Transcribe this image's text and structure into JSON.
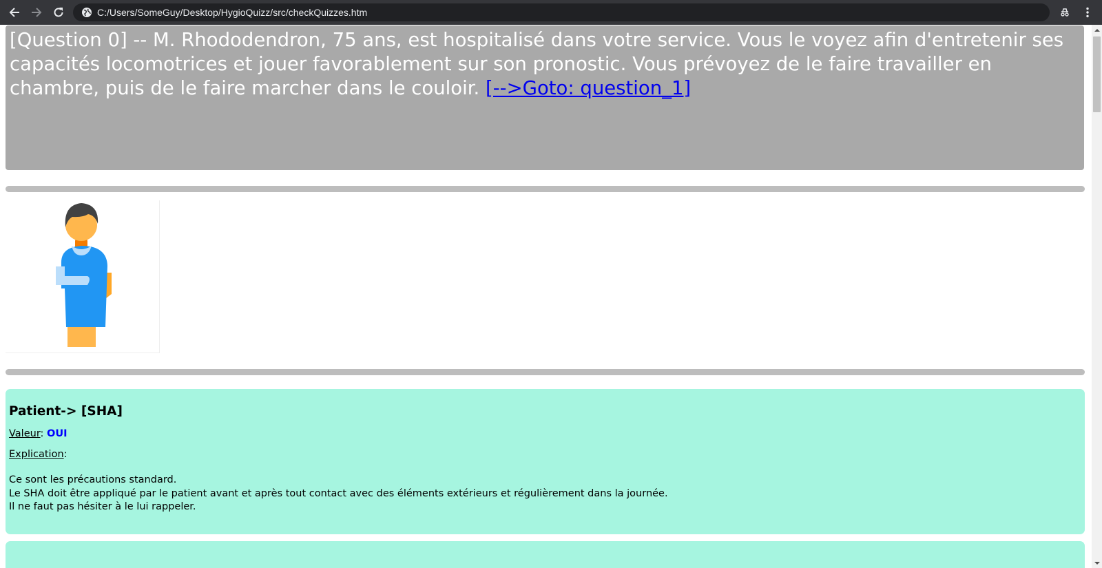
{
  "browser": {
    "url": "C:/Users/SomeGuy/Desktop/HygioQuizz/src/checkQuizzes.htm"
  },
  "question": {
    "text": "[Question 0] -- M. Rhododendron, 75 ans, est hospitalisé dans votre service. Vous le voyez afin d'entretenir ses capacités locomotrices et jouer favorablement sur son pronostic. Vous prévoyez de le faire travailler en chambre, puis de le faire marcher dans le couloir. ",
    "goto_link": "[-->Goto:  question_1]"
  },
  "answer": {
    "title": "Patient-> [SHA]",
    "value_label": "Valeur",
    "value_sep": ": ",
    "value": "OUI",
    "explication_label": "Explication",
    "explication_sep": ":",
    "lines": [
      "Ce sont les précautions standard.",
      "Le SHA doit être appliqué par le patient avant et après tout contact avec des éléments extérieurs et régulièrement dans la journée.",
      "Il ne faut pas hésiter à le lui rappeler."
    ]
  },
  "colors": {
    "question_bg": "#a9a9a9",
    "answer_bg": "#a6f5e0",
    "link": "#0000ee",
    "value": "#0000ff",
    "divider": "#bdbdbd"
  },
  "icons": [
    "back-arrow-icon",
    "forward-arrow-icon",
    "reload-icon",
    "globe-icon",
    "incognito-icon",
    "kebab-menu-icon",
    "patient-figure-icon"
  ]
}
